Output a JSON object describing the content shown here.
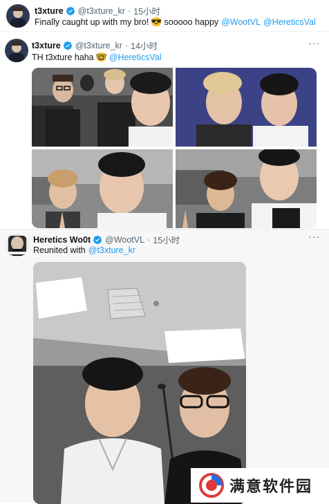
{
  "tweet1": {
    "name": "t3xture",
    "handle": "@t3xture_kr",
    "separator": "·",
    "time": "15小时",
    "text_prefix": "Finally caught up with my bro!",
    "emoji": "😎",
    "text_middle": "sooooo happy",
    "mention1": "@WootVL",
    "mention2": "@HereticsVal",
    "more": "···"
  },
  "tweet2": {
    "name": "t3xture",
    "handle": "@t3xture_kr",
    "separator": "·",
    "time": "14小时",
    "text_prefix": "TH t3xture haha",
    "emoji": "🤓",
    "mention": "@HereticsVal",
    "more": "···",
    "photos": [
      "group-selfie",
      "two-selfie",
      "v-sign-selfie",
      "curly-hair-selfie"
    ]
  },
  "tweet3": {
    "name": "Heretics Wo0t",
    "handle": "@WootVL",
    "separator": "·",
    "time": "15小时",
    "text_prefix": "Reunited with",
    "mention": "@t3xture_kr",
    "more": "···"
  },
  "watermark": {
    "text": "满意软件园"
  },
  "colors": {
    "verified": "#1d9bf0",
    "mention": "#1d9bf0",
    "secondary_text": "#536471"
  }
}
